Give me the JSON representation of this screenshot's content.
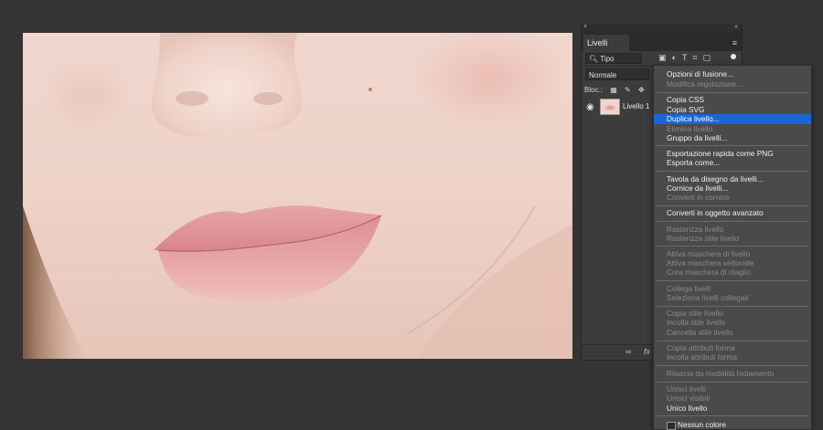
{
  "layers_panel": {
    "tab_label": "Livelli",
    "filter_label": "Tipo",
    "blend_mode": "Normale",
    "lock_label": "Bloc.:",
    "layer_name": "Livello 1",
    "bottom_icons": [
      "link",
      "fx"
    ],
    "bottom_fx": "fx"
  },
  "context_menu": {
    "items": [
      {
        "label": "Opzioni di fusione...",
        "enabled": true
      },
      {
        "label": "Modifica regolazione...",
        "enabled": false
      },
      {
        "label": "Copia CSS",
        "enabled": true
      },
      {
        "label": "Copia SVG",
        "enabled": true
      },
      {
        "label": "Duplica livello...",
        "enabled": true,
        "selected": true
      },
      {
        "label": "Elimina livello",
        "enabled": false
      },
      {
        "label": "Gruppo da livelli...",
        "enabled": true
      },
      {
        "label": "Esportazione rapida come PNG",
        "enabled": true
      },
      {
        "label": "Esporta come...",
        "enabled": true
      },
      {
        "label": "Tavola da disegno da livelli...",
        "enabled": true
      },
      {
        "label": "Cornice da livelli...",
        "enabled": true
      },
      {
        "label": "Converti in cornice",
        "enabled": false
      },
      {
        "label": "Converti in oggetto avanzato",
        "enabled": true
      },
      {
        "label": "Rasterizza livello",
        "enabled": false
      },
      {
        "label": "Rasterizza stile livello",
        "enabled": false
      },
      {
        "label": "Attiva maschera di livello",
        "enabled": false
      },
      {
        "label": "Attiva maschera vettoriale",
        "enabled": false
      },
      {
        "label": "Crea maschera di ritaglio",
        "enabled": false
      },
      {
        "label": "Collega livelli",
        "enabled": false
      },
      {
        "label": "Seleziona livelli collegati",
        "enabled": false
      },
      {
        "label": "Copia stile livello",
        "enabled": false
      },
      {
        "label": "Incolla stile livello",
        "enabled": false
      },
      {
        "label": "Cancella stile livello",
        "enabled": false
      },
      {
        "label": "Copia attributi forma",
        "enabled": false
      },
      {
        "label": "Incolla attributi forma",
        "enabled": false
      },
      {
        "label": "Rilascia da modalità Isolamento",
        "enabled": false
      },
      {
        "label": "Unisci livelli",
        "enabled": false
      },
      {
        "label": "Unisci visibili",
        "enabled": false
      },
      {
        "label": "Unico livello",
        "enabled": true
      },
      {
        "label": "Nessun colore",
        "enabled": true
      }
    ]
  },
  "colors": {
    "menu_highlight": "#1768d4",
    "app_background": "#353535"
  }
}
